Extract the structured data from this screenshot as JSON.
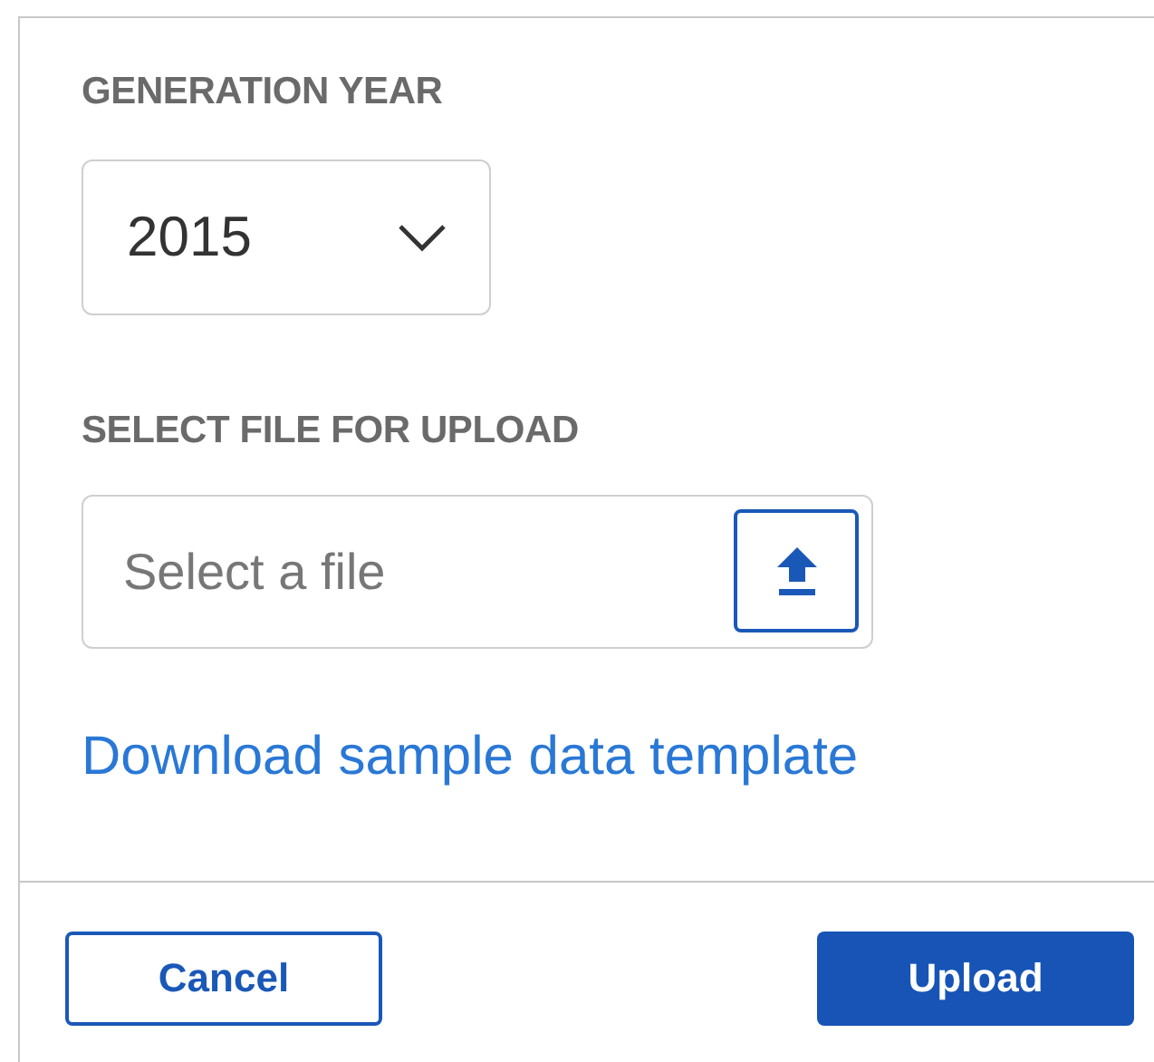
{
  "fields": [
    {
      "kind": "select",
      "label": "GENERATION YEAR",
      "value": "2015"
    },
    {
      "kind": "file",
      "label": "SELECT FILE FOR UPLOAD",
      "placeholder": "Select a file"
    }
  ],
  "link": "Download sample data template",
  "buttons": [
    {
      "label": "Cancel",
      "kind": "secondary"
    },
    {
      "label": "Upload",
      "kind": "primary"
    }
  ]
}
